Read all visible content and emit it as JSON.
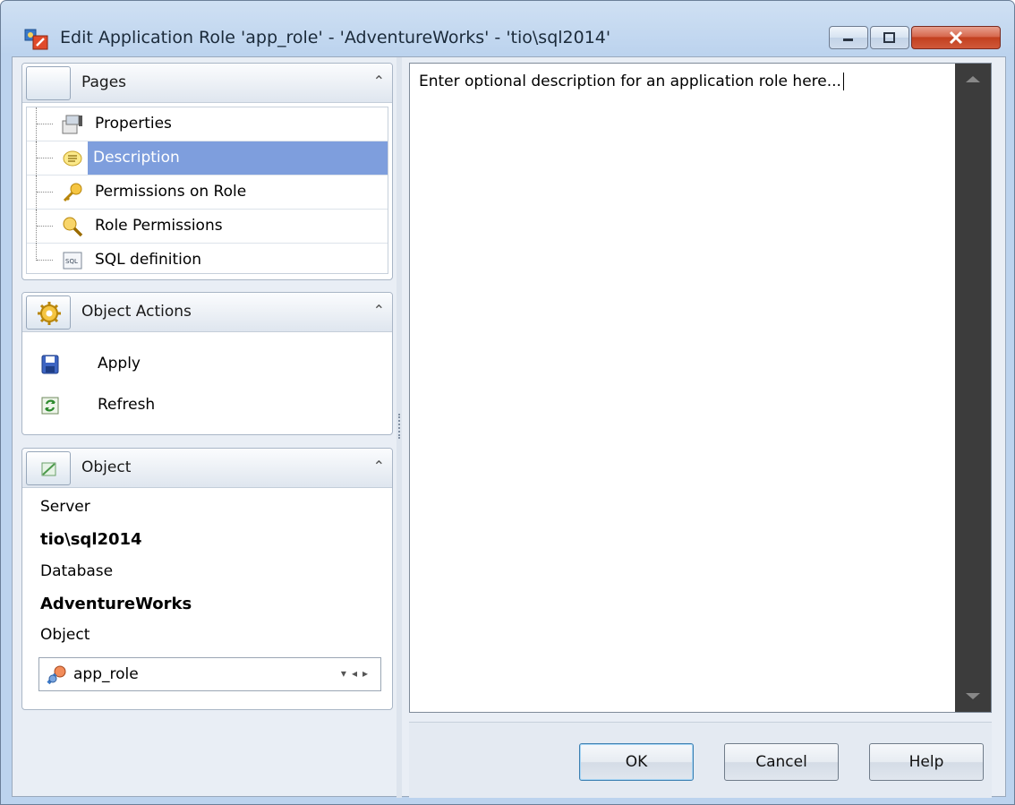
{
  "window": {
    "title": "Edit Application Role 'app_role' - 'AdventureWorks' - 'tio\\sql2014'",
    "icon": "role-edit-icon",
    "controls": {
      "minimize": "minimize-icon",
      "maximize": "maximize-icon",
      "close": "close-icon"
    }
  },
  "pages_panel": {
    "title": "Pages",
    "items": [
      {
        "label": "Properties",
        "icon": "properties-icon",
        "selected": false
      },
      {
        "label": "Description",
        "icon": "description-icon",
        "selected": true
      },
      {
        "label": "Permissions on Role",
        "icon": "key-icon",
        "selected": false
      },
      {
        "label": "Role Permissions",
        "icon": "search-key-icon",
        "selected": false
      },
      {
        "label": "SQL definition",
        "icon": "sql-icon",
        "selected": false
      }
    ]
  },
  "actions_panel": {
    "title": "Object Actions",
    "items": [
      {
        "label": "Apply",
        "icon": "save-icon"
      },
      {
        "label": "Refresh",
        "icon": "refresh-icon"
      }
    ]
  },
  "object_panel": {
    "title": "Object",
    "server_label": "Server",
    "server_value": "tio\\sql2014",
    "database_label": "Database",
    "database_value": "AdventureWorks",
    "object_label": "Object",
    "object_value": "app_role"
  },
  "editor": {
    "text": "Enter optional description for an application role here..."
  },
  "buttons": {
    "ok": "OK",
    "cancel": "Cancel",
    "help": "Help"
  },
  "colors": {
    "selection": "#7e9edd",
    "scrollbar": "#3c3c3c",
    "title_bar": "#bcd3ee",
    "close_button": "#c2401f"
  }
}
